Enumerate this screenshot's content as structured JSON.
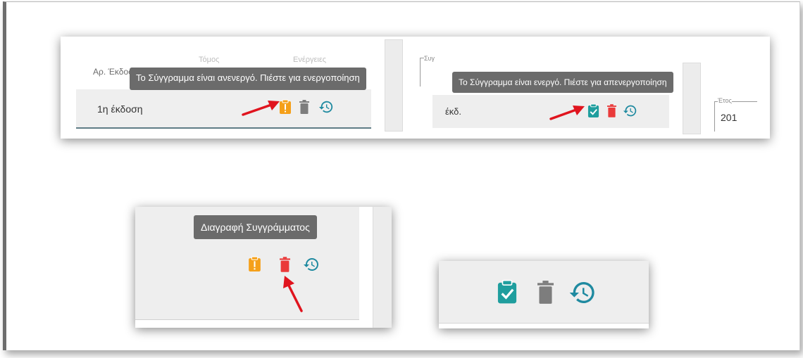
{
  "panel_top": {
    "col_headers": [
      "Αρ. Έκδοσης",
      "Τόμος",
      "Ενέργειες"
    ],
    "tooltip_inactive": "Το Σύγγραμμα είναι ανενεργό. Πιέστε για ενεργοποίηση",
    "tooltip_active": "Το Σύγγραμμα είναι ενεργό. Πιέστε για απενεργοποίηση",
    "row_left_label": "1η έκδοση",
    "row_right_label": "έκδ.",
    "field_label_left": "Συγ",
    "field_label_right": "Έτος",
    "field_value_right": "201"
  },
  "panel_delete": {
    "tooltip": "Διαγραφή Συγγράμματος"
  },
  "colors": {
    "inactive_orange": "#f5a01a",
    "active_teal": "#1f9e9e",
    "delete_red": "#ea3a3a",
    "delete_grey": "#7d7d7d",
    "history_teal": "#1f8aa0",
    "arrow_red": "#e0141e"
  }
}
